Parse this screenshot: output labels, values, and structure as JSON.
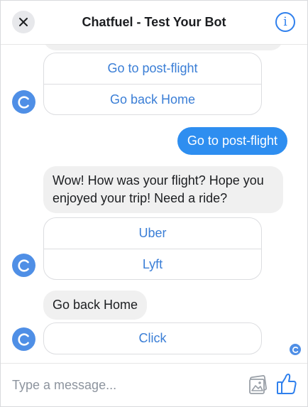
{
  "header": {
    "title": "Chatfuel - Test Your Bot",
    "close_glyph": "✕",
    "info_glyph": "i"
  },
  "messages": {
    "group1": {
      "buttons": [
        "Go to post-flight",
        "Go back Home"
      ]
    },
    "user_message": "Go to post-flight",
    "bot_message_1": "Wow! How was your flight? Hope you enjoyed your trip! Need a ride?",
    "group2": {
      "buttons": [
        "Uber",
        "Lyft"
      ]
    },
    "bot_message_2": "Go back Home",
    "group3": {
      "buttons": [
        "Click"
      ]
    }
  },
  "composer": {
    "placeholder": "Type a message...",
    "value": ""
  },
  "icons": {
    "close": "close-icon",
    "info": "info-icon",
    "bot_avatar": "chatfuel-logo-icon",
    "image_upload": "image-icon",
    "like": "thumbs-up-icon"
  },
  "colors": {
    "accent": "#2f80ed",
    "user_bubble": "#2e8ef0",
    "bot_bubble": "#f0f0f0",
    "button_text": "#3a7ed6",
    "avatar": "#4f8fe6"
  }
}
